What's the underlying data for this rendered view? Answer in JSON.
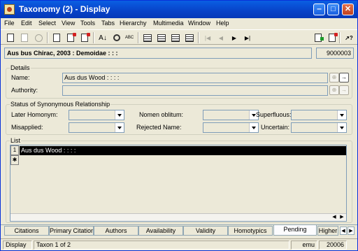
{
  "window": {
    "title": "Taxonomy (2) - Display",
    "min_glyph": "‒",
    "max_glyph": "□",
    "close_glyph": "✕"
  },
  "menu": [
    "File",
    "Edit",
    "Select",
    "View",
    "Tools",
    "Tabs",
    "Hierarchy",
    "Multimedia",
    "Window",
    "Help"
  ],
  "toolbar": {
    "icons": [
      "new-icon",
      "save-icon",
      "disabled-circle-icon",
      "new-record-icon",
      "delete-record-icon",
      "new-from-record-icon",
      "sort-icon",
      "find-icon",
      "spellcheck-icon",
      "details-view-icon",
      "list-view-icon",
      "page-view-icon",
      "attachments-view-icon",
      "first-record-icon",
      "previous-record-icon",
      "next-record-icon",
      "last-record-icon",
      "report-icon",
      "import-icon",
      "help-pointer-icon"
    ],
    "sort_glyph": "A↓",
    "abc_glyph": "ABC",
    "nav_first": "|◀",
    "nav_prev": "◀",
    "nav_next": "▶",
    "nav_last": "▶|",
    "help_glyph": "↗?"
  },
  "record": {
    "title": "Aus bus Chirac, 2003 : Demoidae : : :",
    "irn": "9000003"
  },
  "details": {
    "legend": "Details",
    "name_label": "Name:",
    "name_value": "Aus dus Wood : : : :",
    "authority_label": "Authority:",
    "authority_value": "",
    "attach_glyph": "⊕",
    "go_glyph": "→"
  },
  "synonymy": {
    "legend": "Status of Synonymous Relationship",
    "later_homonym_label": "Later Homonym:",
    "misapplied_label": "Misapplied:",
    "nomen_oblitum_label": "Nomen oblitum:",
    "rejected_name_label": "Rejected Name:",
    "superfluous_label": "Superfluous:",
    "uncertain_label": "Uncertain:"
  },
  "list": {
    "legend": "List",
    "rows": [
      {
        "num": "1",
        "text": "Aus dus Wood : : : :"
      }
    ],
    "new_row_glyph": "✱",
    "scroll_left": "◀",
    "scroll_right": "▶"
  },
  "tabs": [
    "Citations",
    "Primary Citation",
    "Authors",
    "Availability",
    "Validity",
    "Homotypics",
    "Pending",
    "Higher"
  ],
  "active_tab": "Pending",
  "tab_scroll_left": "◀",
  "tab_scroll_right": "▶",
  "status": {
    "mode": "Display",
    "position": "Taxon 1 of 2",
    "user": "emu",
    "port": "20006"
  }
}
